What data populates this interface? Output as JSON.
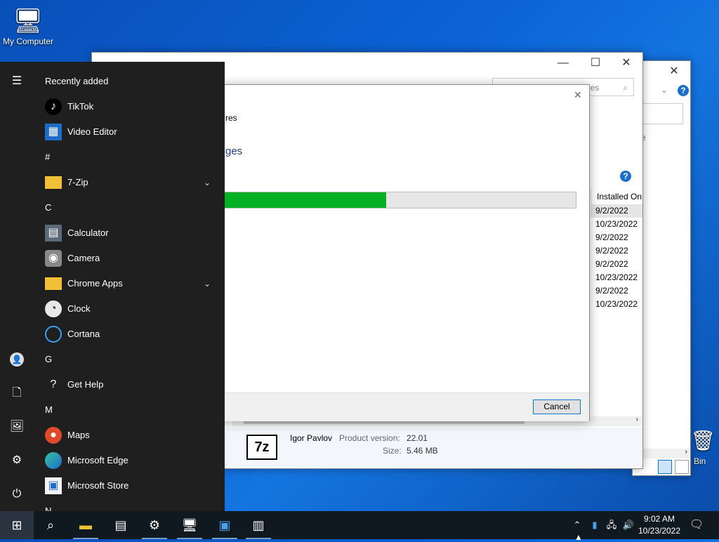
{
  "desktop": {
    "icon_label": "My Computer",
    "recycle_label": "Bin"
  },
  "explorer": {
    "search_placeholder": "atures",
    "detail_snippet": "e"
  },
  "programs_window": {
    "installed_on_header": "Installed On",
    "dates": [
      "9/2/2022",
      "10/23/2022",
      "9/2/2022",
      "9/2/2022",
      "9/2/2022",
      "10/23/2022",
      "9/2/2022",
      "10/23/2022"
    ],
    "details": {
      "publisher": "Igor Pavlov",
      "product_version_label": "Product version:",
      "product_version": "22.01",
      "size_label": "Size:",
      "size": "5.46 MB"
    }
  },
  "dialog": {
    "line1": "res",
    "line2": "ges",
    "progress": 0.46,
    "cancel_label": "Cancel"
  },
  "start_menu": {
    "recently_added": "Recently added",
    "items": [
      {
        "type": "app",
        "label": "TikTok",
        "icon": "tiktok-icon"
      },
      {
        "type": "app",
        "label": "Video Editor",
        "icon": "video-editor-icon"
      },
      {
        "type": "header",
        "label": "#"
      },
      {
        "type": "folder",
        "label": "7-Zip",
        "icon": "folder-icon"
      },
      {
        "type": "header",
        "label": "C"
      },
      {
        "type": "app",
        "label": "Calculator",
        "icon": "calculator-icon"
      },
      {
        "type": "app",
        "label": "Camera",
        "icon": "camera-icon"
      },
      {
        "type": "folder",
        "label": "Chrome Apps",
        "icon": "folder-icon"
      },
      {
        "type": "app",
        "label": "Clock",
        "icon": "clock-icon"
      },
      {
        "type": "app",
        "label": "Cortana",
        "icon": "cortana-icon"
      },
      {
        "type": "header",
        "label": "G"
      },
      {
        "type": "app",
        "label": "Get Help",
        "icon": "get-help-icon"
      },
      {
        "type": "header",
        "label": "M"
      },
      {
        "type": "app",
        "label": "Maps",
        "icon": "maps-icon"
      },
      {
        "type": "app",
        "label": "Microsoft Edge",
        "icon": "edge-icon"
      },
      {
        "type": "app",
        "label": "Microsoft Store",
        "icon": "store-icon"
      },
      {
        "type": "header",
        "label": "N"
      }
    ]
  },
  "taskbar": {
    "time": "9:02 AM",
    "date": "10/23/2022"
  },
  "colors": {
    "progress_fill": "#06b025",
    "accent": "#0078d7"
  }
}
